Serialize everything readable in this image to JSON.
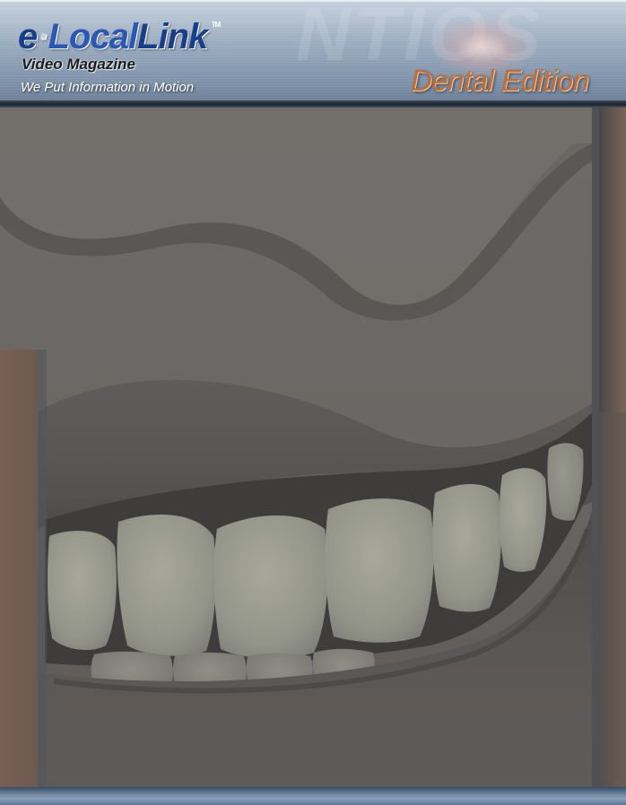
{
  "header": {
    "logo": {
      "part_a": "e",
      "dot": "·",
      "part_b_local": "Local",
      "part_b_link": "Link",
      "trademark": "TM"
    },
    "subtitle": "Video Magazine",
    "tagline": "We Put Information in Motion",
    "edition": "Dental Edition",
    "watermark": "NTIOS"
  },
  "photo": {
    "subject": "smile-closeup-image"
  },
  "colors": {
    "header_top": "#c6d1dd",
    "header_bottom": "#6e8198",
    "logo_blue": "#1a3f8a",
    "logo_light_blue": "#2a58b5",
    "edition_copper": "#bf6e3c",
    "footer_blue": "#6d86a3"
  }
}
